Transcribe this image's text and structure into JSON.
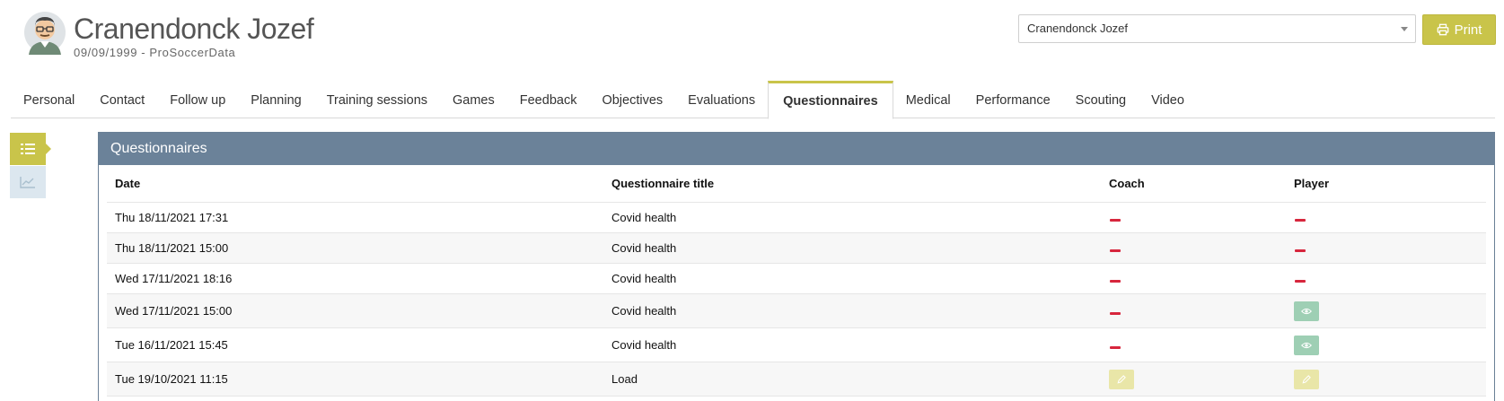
{
  "player": {
    "name": "Cranendonck Jozef",
    "subtitle": "09/09/1999 - ProSoccerData"
  },
  "selector": {
    "value": "Cranendonck Jozef"
  },
  "print": {
    "label": "Print"
  },
  "tabs": [
    {
      "label": "Personal"
    },
    {
      "label": "Contact"
    },
    {
      "label": "Follow up"
    },
    {
      "label": "Planning"
    },
    {
      "label": "Training sessions"
    },
    {
      "label": "Games"
    },
    {
      "label": "Feedback"
    },
    {
      "label": "Objectives"
    },
    {
      "label": "Evaluations"
    },
    {
      "label": "Questionnaires"
    },
    {
      "label": "Medical"
    },
    {
      "label": "Performance"
    },
    {
      "label": "Scouting"
    },
    {
      "label": "Video"
    }
  ],
  "active_tab": "Questionnaires",
  "panel": {
    "title": "Questionnaires",
    "columns": {
      "date": "Date",
      "title": "Questionnaire title",
      "coach": "Coach",
      "player": "Player"
    },
    "rows": [
      {
        "date": "Thu 18/11/2021 17:31",
        "title": "Covid health",
        "coach": "none",
        "player": "none"
      },
      {
        "date": "Thu 18/11/2021 15:00",
        "title": "Covid health",
        "coach": "none",
        "player": "none"
      },
      {
        "date": "Wed 17/11/2021 18:16",
        "title": "Covid health",
        "coach": "none",
        "player": "none"
      },
      {
        "date": "Wed 17/11/2021 15:00",
        "title": "Covid health",
        "coach": "none",
        "player": "view"
      },
      {
        "date": "Tue 16/11/2021 15:45",
        "title": "Covid health",
        "coach": "none",
        "player": "view"
      },
      {
        "date": "Tue 19/10/2021 11:15",
        "title": "Load",
        "coach": "edit",
        "player": "edit"
      }
    ]
  },
  "colors": {
    "accent": "#c9c44a",
    "panel_header": "#6b8299",
    "dash": "#d7263d",
    "view_button": "#9ecfb4",
    "edit_button": "#e9e6a8"
  },
  "icons": {
    "print": "printer-icon",
    "list_view": "list-icon",
    "chart_view": "line-chart-icon",
    "view": "eye-icon",
    "edit": "pencil-icon",
    "no_entry": "dash-icon"
  }
}
